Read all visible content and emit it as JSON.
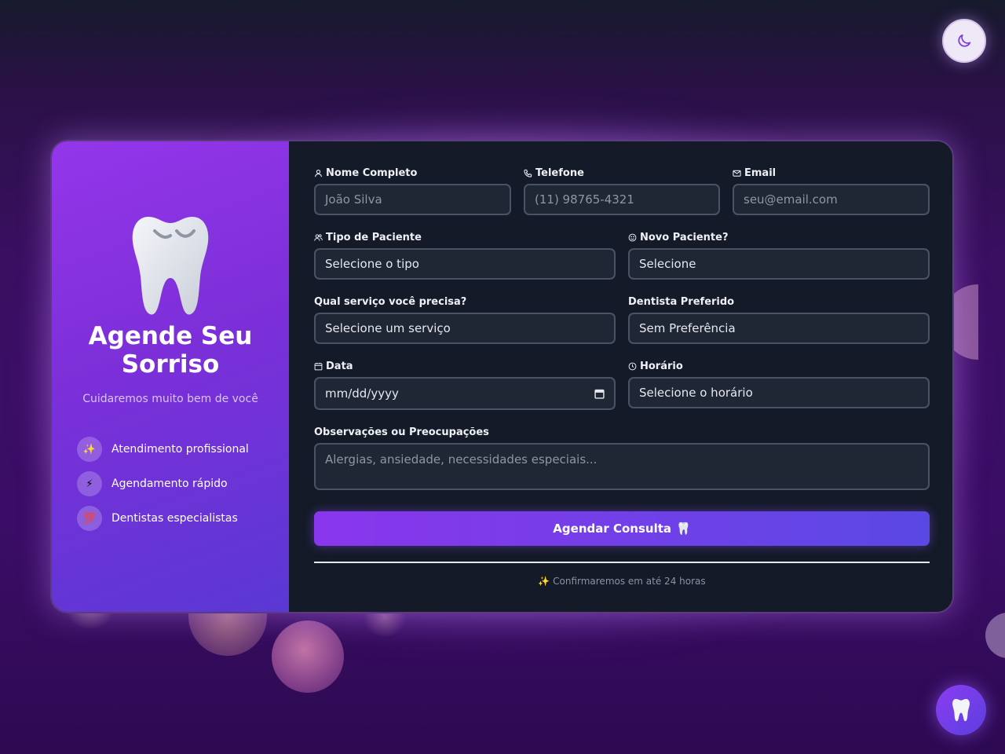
{
  "brand": {
    "title": "Agende Seu Sorriso",
    "subtitle": "Cuidaremos muito bem de você",
    "icon": "tooth-icon"
  },
  "features": [
    {
      "icon": "✨",
      "label": "Atendimento profissional"
    },
    {
      "icon": "⚡",
      "label": "Agendamento rápido"
    },
    {
      "icon": "💯",
      "label": "Dentistas especialistas"
    }
  ],
  "form": {
    "name": {
      "label": "Nome Completo",
      "placeholder": "João Silva"
    },
    "phone": {
      "label": "Telefone",
      "placeholder": "(11) 98765-4321"
    },
    "email": {
      "label": "Email",
      "placeholder": "seu@email.com"
    },
    "patient_type": {
      "label": "Tipo de Paciente",
      "value": "Selecione o tipo"
    },
    "new_patient": {
      "label": "Novo Paciente?",
      "value": "Selecione"
    },
    "service": {
      "label": "Qual serviço você precisa?",
      "value": "Selecione um serviço"
    },
    "dentist": {
      "label": "Dentista Preferido",
      "value": "Sem Preferência"
    },
    "date": {
      "label": "Data",
      "placeholder": "mm/dd/yyyy"
    },
    "time": {
      "label": "Horário",
      "value": "Selecione o horário"
    },
    "notes": {
      "label": "Observações ou Preocupações",
      "placeholder": "Alergias, ansiedade, necessidades especiais..."
    },
    "submit_label": "Agendar Consulta",
    "submit_emoji": "🦷",
    "footer_note": "✨ Confirmaremos em até 24 horas"
  },
  "colors": {
    "accent": "#8a36ec",
    "panel": "#141a27",
    "field": "#1f2734"
  }
}
